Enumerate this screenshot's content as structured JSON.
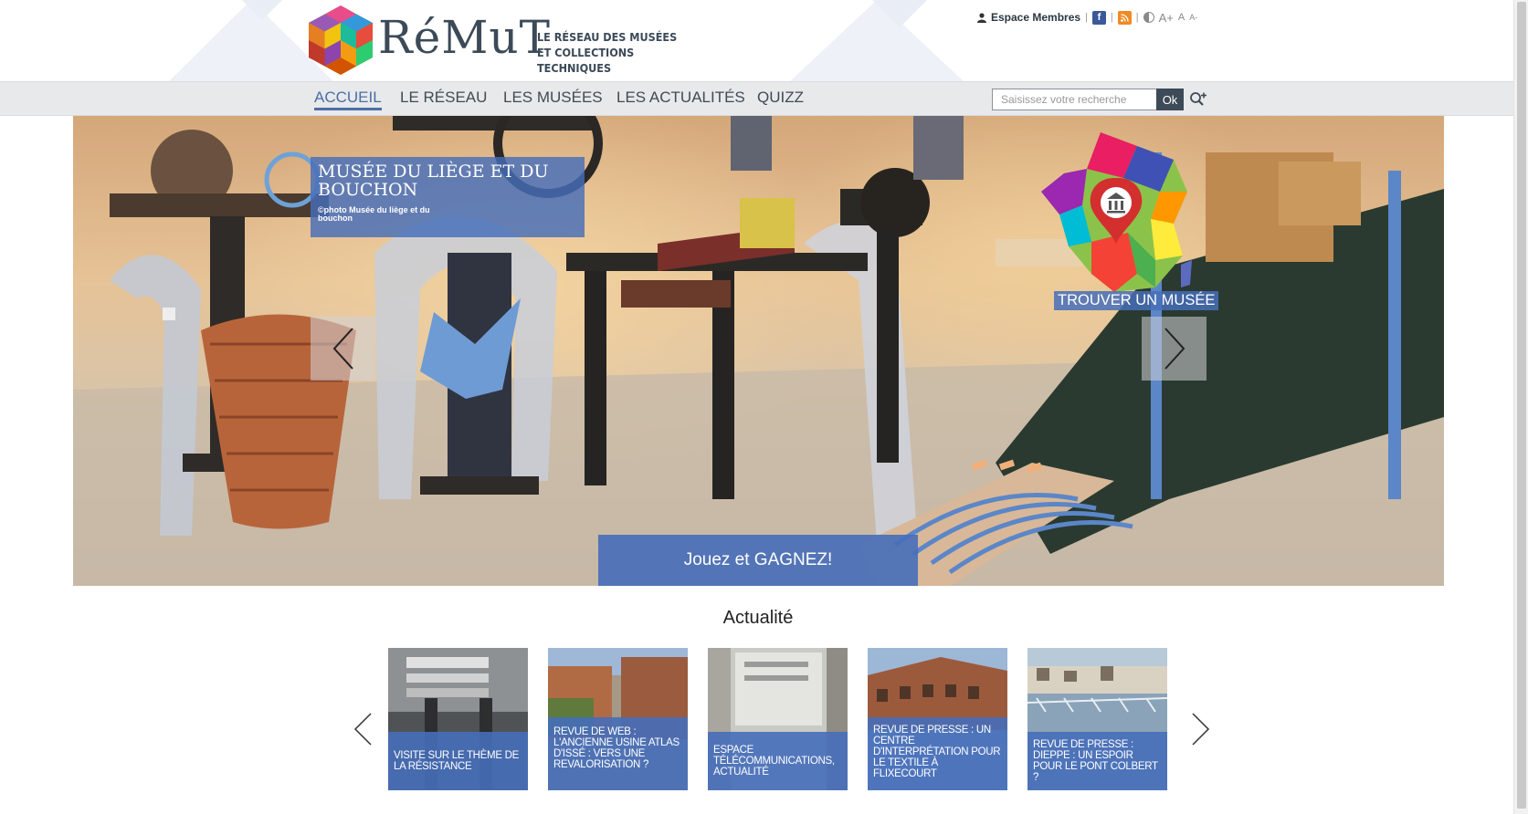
{
  "header": {
    "brand": "RéMuT",
    "tagline": "Le réseau des musées et collections techniques",
    "members_link": "Espace Membres",
    "icons": [
      "user-icon",
      "facebook-icon",
      "rss-icon",
      "contrast-icon",
      "font-increase-icon",
      "font-reset-icon",
      "font-decrease-icon"
    ],
    "font_controls": {
      "increase": "A+",
      "reset": "A",
      "decrease": "A-"
    },
    "facebook_glyph": "f"
  },
  "nav": {
    "items": [
      {
        "label": "ACCUEIL",
        "active": true
      },
      {
        "label": "LE RÉSEAU",
        "active": false
      },
      {
        "label": "LES MUSÉES",
        "active": false
      },
      {
        "label": "LES ACTUALITÉS",
        "active": false
      },
      {
        "label": "QUIZZ",
        "active": false
      }
    ],
    "search": {
      "placeholder": "Saisissez votre recherche",
      "button": "Ok"
    }
  },
  "slider": {
    "caption_title": "Musée du Liège et du Bouchon",
    "caption_credit": "©photo Musée du liège et du bouchon",
    "find_museum": "TROUVER UN MUSÉE",
    "play_button": "Jouez et GAGNEZ!"
  },
  "news": {
    "title": "Actualité",
    "items": [
      {
        "title": "VISITE SUR LE THÈME DE LA RÉSISTANCE"
      },
      {
        "title": "REVUE DE WEB : L'ANCIENNE USINE ATLAS D'ISSÉ : VERS UNE REVALORISATION ?"
      },
      {
        "title": "ESPACE TÉLÉCOMMUNICATIONS, ACTUALITÉ"
      },
      {
        "title": "REVUE DE PRESSE : UN CENTRE D'INTERPRÉTATION POUR LE TEXTILE À FLIXECOURT"
      },
      {
        "title": "REVUE DE PRESSE : DIEPPE : UN ESPOIR POUR LE PONT COLBERT ?"
      }
    ]
  },
  "colors": {
    "accent": "#4a6fa8",
    "overlay_blue": "#466eb9",
    "text_dark": "#3c4a58",
    "nav_bg": "#e8e9ea"
  }
}
